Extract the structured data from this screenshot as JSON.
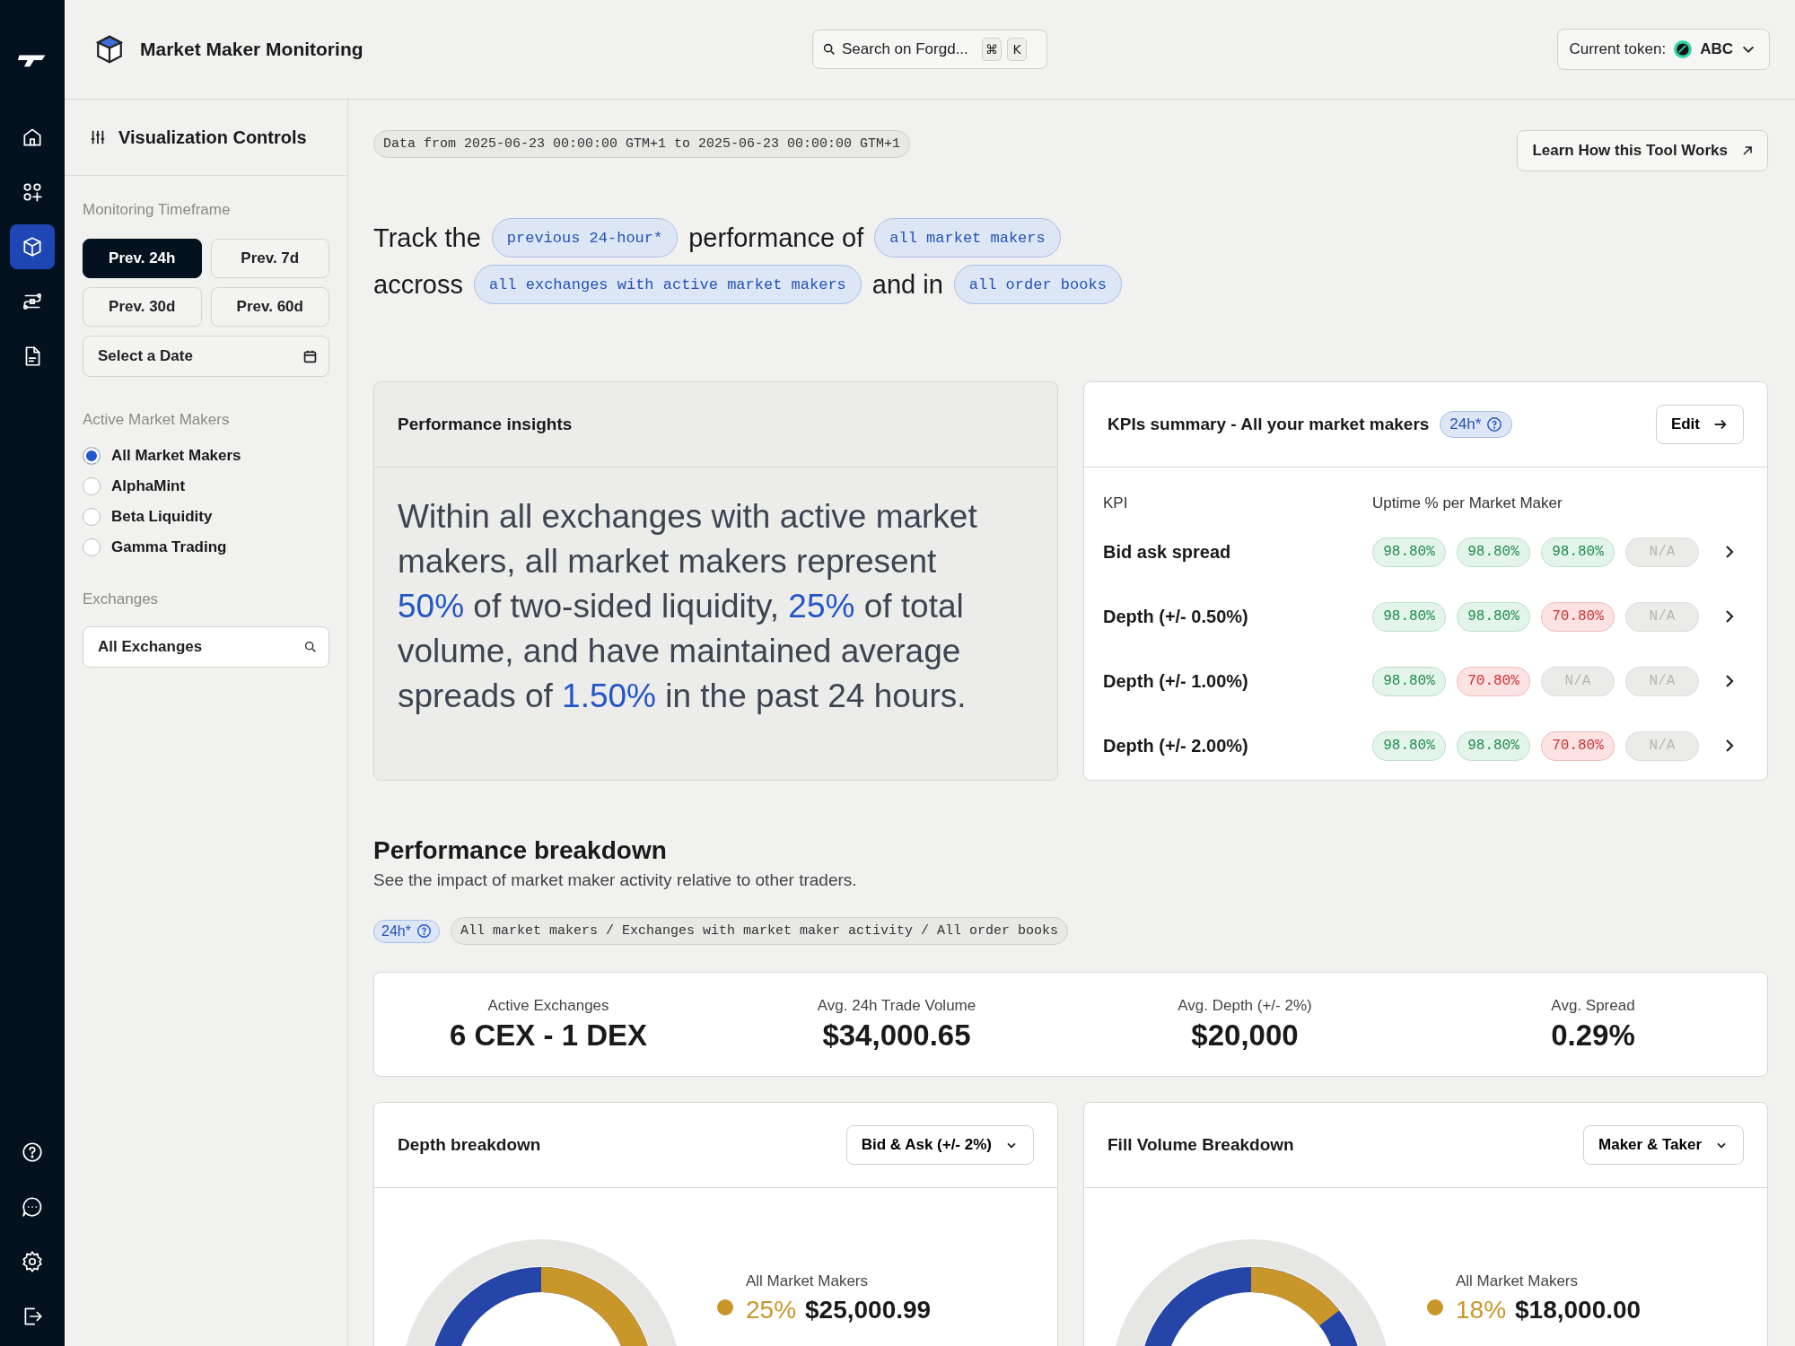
{
  "rail": {
    "top": [
      {
        "kind": "home",
        "selected": false
      },
      {
        "kind": "apps",
        "selected": false
      },
      {
        "kind": "cube",
        "selected": true
      },
      {
        "kind": "exchange",
        "selected": false
      },
      {
        "kind": "document",
        "selected": false
      }
    ],
    "bottom": [
      {
        "kind": "help"
      },
      {
        "kind": "chat"
      },
      {
        "kind": "settings"
      },
      {
        "kind": "logout"
      }
    ]
  },
  "header": {
    "title": "Market Maker Monitoring",
    "search": {
      "placeholder": "Search on Forgd...",
      "keys": [
        "⌘",
        "K"
      ]
    },
    "token": {
      "label": "Current token:",
      "value": "ABC"
    }
  },
  "controls": {
    "title": "Visualization Controls",
    "timeframe": {
      "label": "Monitoring Timeframe",
      "options": [
        {
          "label": "Prev. 24h",
          "selected": true
        },
        {
          "label": "Prev. 7d",
          "selected": false
        },
        {
          "label": "Prev. 30d",
          "selected": false
        },
        {
          "label": "Prev. 60d",
          "selected": false
        }
      ],
      "date_placeholder": "Select a Date"
    },
    "makers": {
      "label": "Active Market Makers",
      "options": [
        {
          "label": "All Market Makers",
          "selected": true
        },
        {
          "label": "AlphaMint",
          "selected": false
        },
        {
          "label": "Beta Liquidity",
          "selected": false
        },
        {
          "label": "Gamma Trading",
          "selected": false
        }
      ]
    },
    "exchanges": {
      "label": "Exchanges",
      "value": "All Exchanges"
    }
  },
  "range": "Data from 2025-06-23 00:00:00 GTM+1 to 2025-06-23 00:00:00 GTM+1",
  "learn_button": "Learn How this Tool Works",
  "track_lines": [
    [
      {
        "kind": "text",
        "text": "Track the"
      },
      {
        "kind": "chip",
        "text": "previous 24-hour*"
      },
      {
        "kind": "text",
        "text": "performance of"
      },
      {
        "kind": "chip",
        "text": "all market makers"
      }
    ],
    [
      {
        "kind": "text",
        "text": "accross"
      },
      {
        "kind": "chip",
        "text": "all exchanges with active market makers"
      },
      {
        "kind": "text",
        "text": "and in"
      },
      {
        "kind": "chip",
        "text": "all order books"
      }
    ]
  ],
  "insights": {
    "title": "Performance insights",
    "text": "Within all exchanges with active market makers, all market makers represent **50%** of two-sided liquidity, **25%** of total volume, and have maintained average spreads of **1.50%** in the past 24 hours."
  },
  "kpis": {
    "title": "KPIs summary - All your market makers",
    "badge": "24h*",
    "edit": "Edit",
    "columns": [
      "KPI",
      "Uptime % per Market Maker"
    ],
    "rows": [
      {
        "name": "Bid ask spread",
        "values": [
          {
            "text": "98.80%",
            "kind": "good"
          },
          {
            "text": "98.80%",
            "kind": "good"
          },
          {
            "text": "98.80%",
            "kind": "good"
          },
          {
            "text": "N/A",
            "kind": "na"
          }
        ]
      },
      {
        "name": "Depth (+/- 0.50%)",
        "values": [
          {
            "text": "98.80%",
            "kind": "good"
          },
          {
            "text": "98.80%",
            "kind": "good"
          },
          {
            "text": "70.80%",
            "kind": "bad"
          },
          {
            "text": "N/A",
            "kind": "na"
          }
        ]
      },
      {
        "name": "Depth (+/- 1.00%)",
        "values": [
          {
            "text": "98.80%",
            "kind": "good"
          },
          {
            "text": "70.80%",
            "kind": "bad"
          },
          {
            "text": "N/A",
            "kind": "na"
          },
          {
            "text": "N/A",
            "kind": "na"
          }
        ]
      },
      {
        "name": "Depth (+/- 2.00%)",
        "values": [
          {
            "text": "98.80%",
            "kind": "good"
          },
          {
            "text": "98.80%",
            "kind": "good"
          },
          {
            "text": "70.80%",
            "kind": "bad"
          },
          {
            "text": "N/A",
            "kind": "na"
          }
        ]
      }
    ]
  },
  "breakdown": {
    "title": "Performance breakdown",
    "subtitle": "See the impact of market maker activity relative to other traders.",
    "badge": "24h*",
    "filter": "All market makers / Exchanges with market maker activity / All order books",
    "stats": [
      {
        "label": "Active Exchanges",
        "value": "6 CEX - 1 DEX"
      },
      {
        "label": "Avg. 24h Trade Volume",
        "value": "$34,000.65"
      },
      {
        "label": "Avg. Depth (+/- 2%)",
        "value": "$20,000"
      },
      {
        "label": "Avg. Spread",
        "value": "0.29%"
      }
    ]
  },
  "panels": [
    {
      "title": "Depth breakdown",
      "dropdown": "Bid & Ask (+/- 2%)",
      "legend": {
        "label": "All Market Makers",
        "percent": "25%",
        "amount": "$25,000.99",
        "color": "#c9962a"
      }
    },
    {
      "title": "Fill Volume Breakdown",
      "dropdown": "Maker & Taker",
      "legend": {
        "label": "All Market Makers",
        "percent": "18%",
        "amount": "$18,000.00",
        "color": "#c9962a"
      }
    }
  ]
}
